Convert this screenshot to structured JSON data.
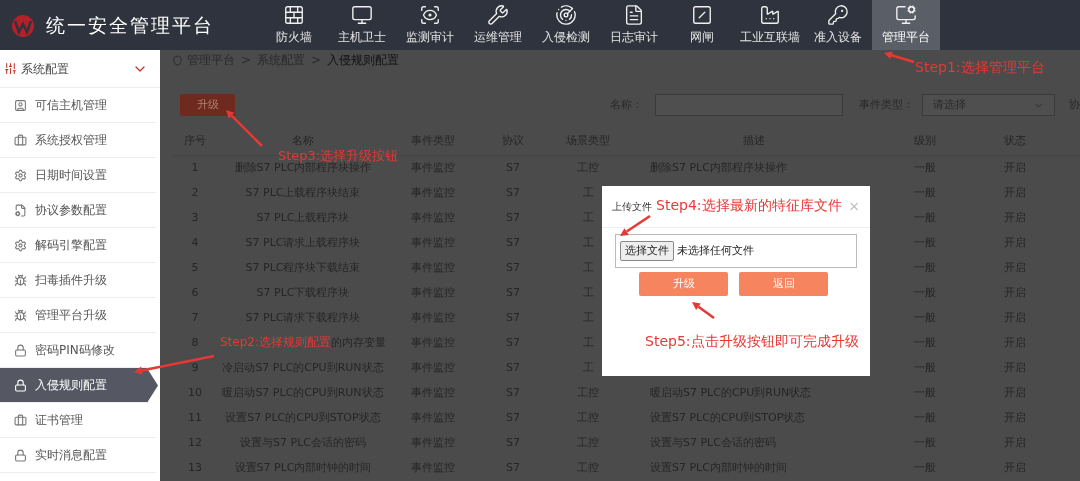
{
  "app": {
    "title": "统一安全管理平台"
  },
  "nav": [
    {
      "label": "防火墙",
      "selected": false
    },
    {
      "label": "主机卫士",
      "selected": false
    },
    {
      "label": "监测审计",
      "selected": false
    },
    {
      "label": "运维管理",
      "selected": false
    },
    {
      "label": "入侵检测",
      "selected": false
    },
    {
      "label": "日志审计",
      "selected": false
    },
    {
      "label": "网闸",
      "selected": false
    },
    {
      "label": "工业互联墙",
      "selected": false
    },
    {
      "label": "准入设备",
      "selected": false
    },
    {
      "label": "管理平台",
      "selected": true
    }
  ],
  "sidebar": {
    "group": {
      "label": "系统配置",
      "expanded": true
    },
    "items": [
      {
        "label": "可信主机管理",
        "selected": false
      },
      {
        "label": "系统授权管理",
        "selected": false
      },
      {
        "label": "日期时间设置",
        "selected": false
      },
      {
        "label": "协议参数配置",
        "selected": false
      },
      {
        "label": "解码引擎配置",
        "selected": false
      },
      {
        "label": "扫毒插件升级",
        "selected": false
      },
      {
        "label": "管理平台升级",
        "selected": false
      },
      {
        "label": "密码PIN码修改",
        "selected": false
      },
      {
        "label": "入侵规则配置",
        "selected": true
      },
      {
        "label": "证书管理",
        "selected": false
      },
      {
        "label": "实时消息配置",
        "selected": false
      }
    ]
  },
  "breadcrumb": {
    "items": [
      "管理平台",
      "系统配置",
      "入侵规则配置"
    ],
    "separator": ">"
  },
  "toolbar": {
    "upgrade_button": "升级",
    "name_label": "名称：",
    "event_type_label": "事件类型：",
    "event_type_value": "请选择",
    "protocol_label": "协"
  },
  "table": {
    "columns": [
      "序号",
      "名称",
      "事件类型",
      "协议",
      "场景类型",
      "描述",
      "级别",
      "状态"
    ],
    "rows": [
      [
        "1",
        "删除S7 PLC内部程序块操作",
        "事件监控",
        "S7",
        "工控",
        "删除S7 PLC内部程序块操作",
        "一般",
        "开启"
      ],
      [
        "2",
        "S7 PLC上载程序块结束",
        "事件监控",
        "S7",
        "工",
        "",
        "一般",
        "开启"
      ],
      [
        "3",
        "S7 PLC上载程序块",
        "事件监控",
        "S7",
        "工",
        "",
        "一般",
        "开启"
      ],
      [
        "4",
        "S7 PLC请求上载程序块",
        "事件监控",
        "S7",
        "工",
        "",
        "一般",
        "开启"
      ],
      [
        "5",
        "S7 PLC程序块下载结束",
        "事件监控",
        "S7",
        "工",
        "",
        "一般",
        "开启"
      ],
      [
        "6",
        "S7 PLC下载程序块",
        "事件监控",
        "S7",
        "工",
        "",
        "一般",
        "开启"
      ],
      [
        "7",
        "S7 PLC请求下载程序块",
        "事件监控",
        "S7",
        "工",
        "",
        "一般",
        "开启"
      ],
      [
        "8",
        "的内存变量",
        "事件监控",
        "S7",
        "工",
        "",
        "一般",
        "开启"
      ],
      [
        "9",
        "冷启动S7 PLC的CPU到RUN状态",
        "事件监控",
        "S7",
        "工",
        "",
        "一般",
        "开启"
      ],
      [
        "10",
        "暖启动S7 PLC的CPU到RUN状态",
        "事件监控",
        "S7",
        "工控",
        "暖启动S7 PLC的CPU到RUN状态",
        "一般",
        "开启"
      ],
      [
        "11",
        "设置S7 PLC的CPU到STOP状态",
        "事件监控",
        "S7",
        "工控",
        "设置S7 PLC的CPU到STOP状态",
        "一般",
        "开启"
      ],
      [
        "12",
        "设置与S7 PLC会话的密码",
        "事件监控",
        "S7",
        "工控",
        "设置与S7 PLC会话的密码",
        "一般",
        "开启"
      ],
      [
        "13",
        "设置S7 PLC内部时钟的时间",
        "事件监控",
        "S7",
        "工控",
        "设置S7 PLC内部时钟的时间",
        "一般",
        "开启"
      ]
    ]
  },
  "dialog": {
    "title": "上传文件",
    "close": "×",
    "file_button": "选择文件",
    "file_status": "未选择任何文件",
    "buttons": [
      "升级",
      "返回"
    ]
  },
  "annotations": [
    "Step1:选择管理平台",
    "Step3:选择升级按钮",
    "Step4:选择最新的特征库文件",
    "Step2:选择规则配置",
    "Step5:点击升级按钮即可完成升级"
  ]
}
